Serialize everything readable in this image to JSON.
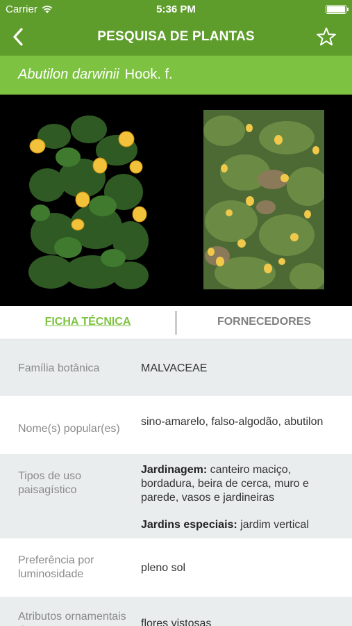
{
  "status_bar": {
    "carrier": "Carrier",
    "time": "5:36 PM"
  },
  "nav": {
    "title": "PESQUISA DE PLANTAS",
    "back_icon": "chevron-left-icon",
    "favorite_icon": "star-outline-icon"
  },
  "species": {
    "scientific_name": "Abutilon darwinii",
    "author": "Hook. f."
  },
  "tabs": [
    {
      "label": "FICHA TÉCNICA",
      "active": true
    },
    {
      "label": "FORNECEDORES",
      "active": false
    }
  ],
  "details": {
    "familia_label": "Família botânica",
    "familia_value": "MALVACEAE",
    "nomes_label": "Nome(s) popular(es)",
    "nomes_value": "sino-amarelo, falso-algodão, abutilon",
    "uso_label": "Tipos de uso paisagístico",
    "uso_jardinagem_key": "Jardinagem:",
    "uso_jardinagem_value": " canteiro maciço, bordadura, beira de cerca, muro e parede, vasos e jardineiras",
    "uso_especiais_key": "Jardins especiais:",
    "uso_especiais_value": " jardim vertical",
    "luz_label": "Preferência por luminosidade",
    "luz_value": "pleno sol",
    "atributos_label": "Atributos ornamentais da",
    "atributos_value": "flores vistosas"
  },
  "colors": {
    "nav_green": "#5e9d2b",
    "accent_green": "#7dc341",
    "row_shade": "#e9edee"
  }
}
